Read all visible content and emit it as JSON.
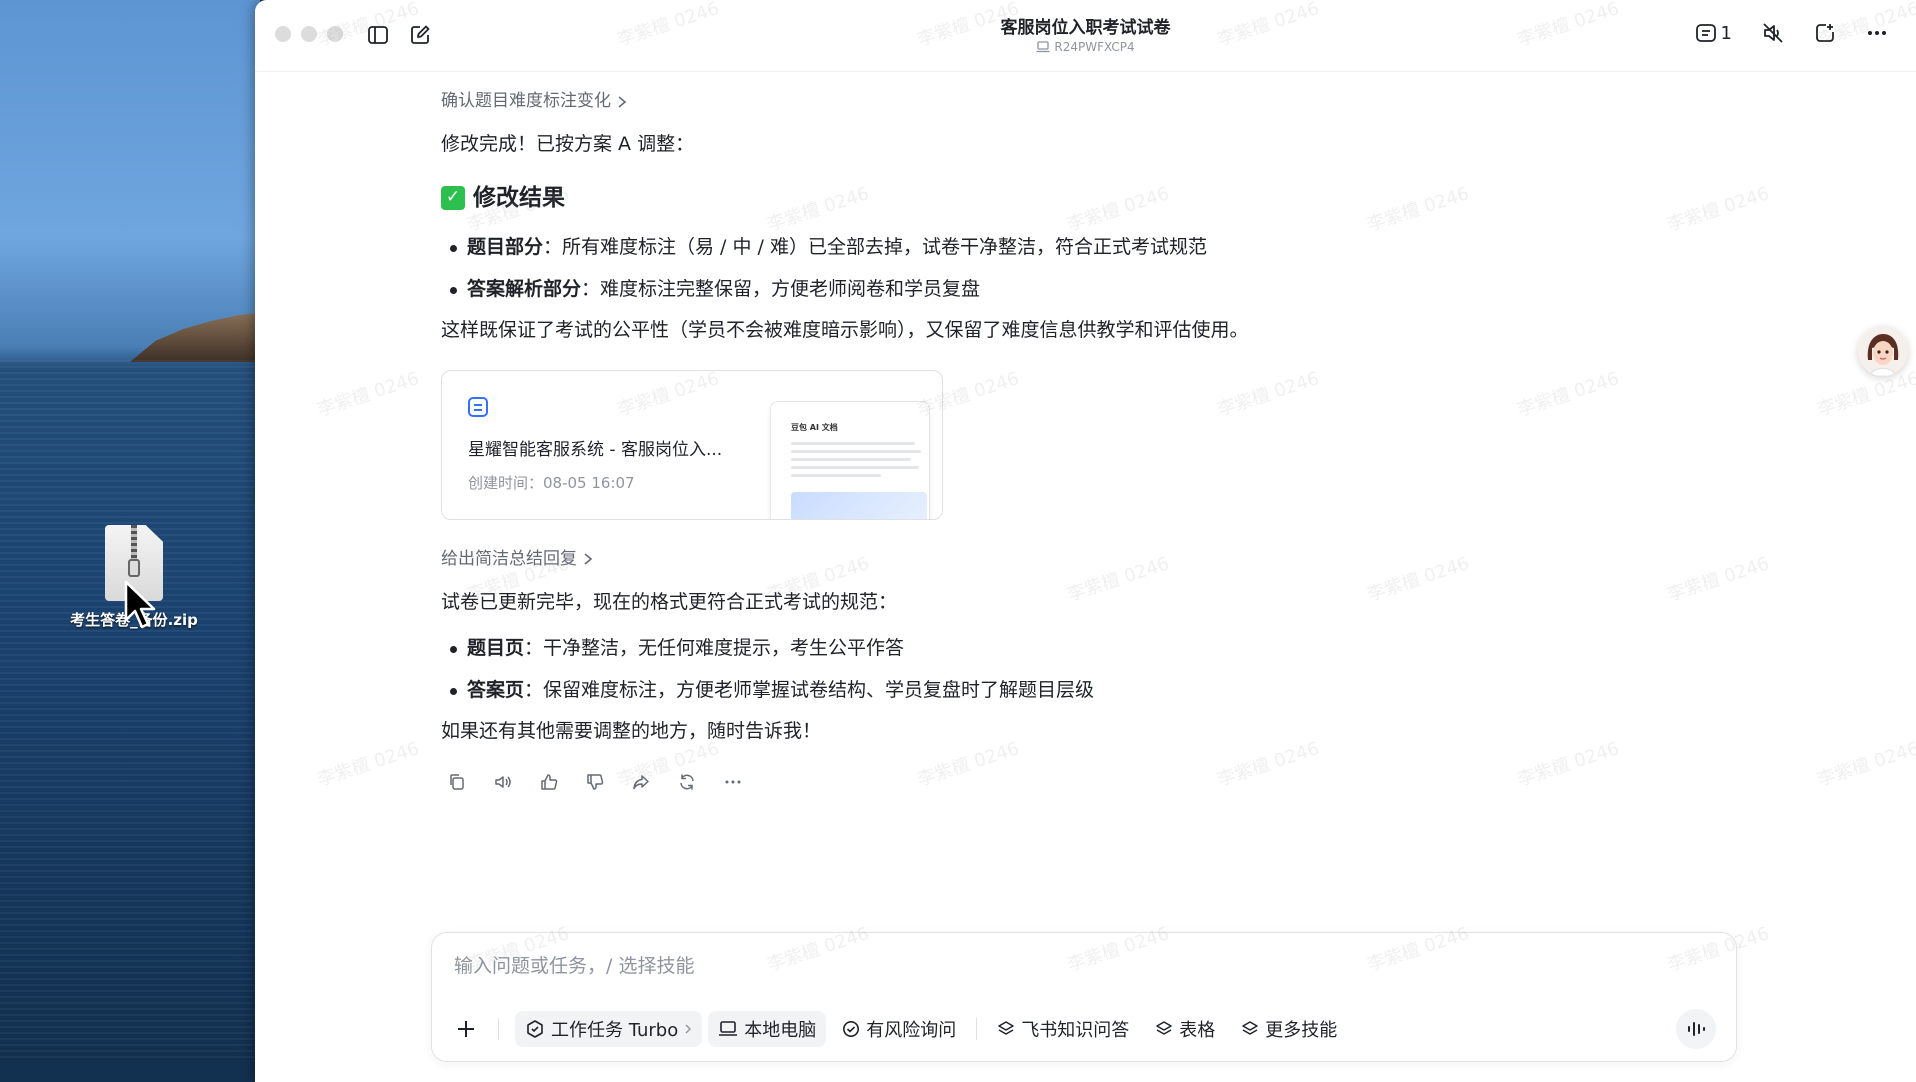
{
  "desktop": {
    "zip_file_label": "考生答卷_备份.zip",
    "zip_icon": "zip-archive-icon"
  },
  "window": {
    "title": "客服岗位入职考试试卷",
    "subtitle": "R24PWFXCP4",
    "subtitle_icon": "laptop-icon",
    "message_count": "1"
  },
  "messages": {
    "step_link_1": "确认题目难度标注变化",
    "intro_1": "修改完成！已按方案 A 调整：",
    "heading": "修改结果",
    "bullets_1": [
      {
        "label": "题目部分",
        "text": "：所有难度标注（易 / 中 / 难）已全部去掉，试卷干净整洁，符合正式考试规范"
      },
      {
        "label": "答案解析部分",
        "text": "：难度标注完整保留，方便老师阅卷和学员复盘"
      }
    ],
    "summary_1": "这样既保证了考试的公平性（学员不会被难度暗示影响），又保留了难度信息供教学和评估使用。",
    "doc_card": {
      "title": "星耀智能客服系统 - 客服岗位入...",
      "created": "创建时间：08-05 16:07",
      "preview_title": "豆包 AI 文档"
    },
    "step_link_2": "给出简洁总结回复",
    "intro_2": "试卷已更新完毕，现在的格式更符合正式考试的规范：",
    "bullets_2": [
      {
        "label": "题目页",
        "text": "：干净整洁，无任何难度提示，考生公平作答"
      },
      {
        "label": "答案页",
        "text": "：保留难度标注，方便老师掌握试卷结构、学员复盘时了解题目层级"
      }
    ],
    "closing": "如果还有其他需要调整的地方，随时告诉我！"
  },
  "composer": {
    "placeholder": "输入问题或任务，/ 选择技能",
    "chips": {
      "work_task": "工作任务 Turbo",
      "local_pc": "本地电脑",
      "risk_query": "有风险询问",
      "feishu_qa": "飞书知识问答",
      "sheet": "表格",
      "more_skills": "更多技能"
    }
  },
  "watermark_text": "李紫檀 0246"
}
